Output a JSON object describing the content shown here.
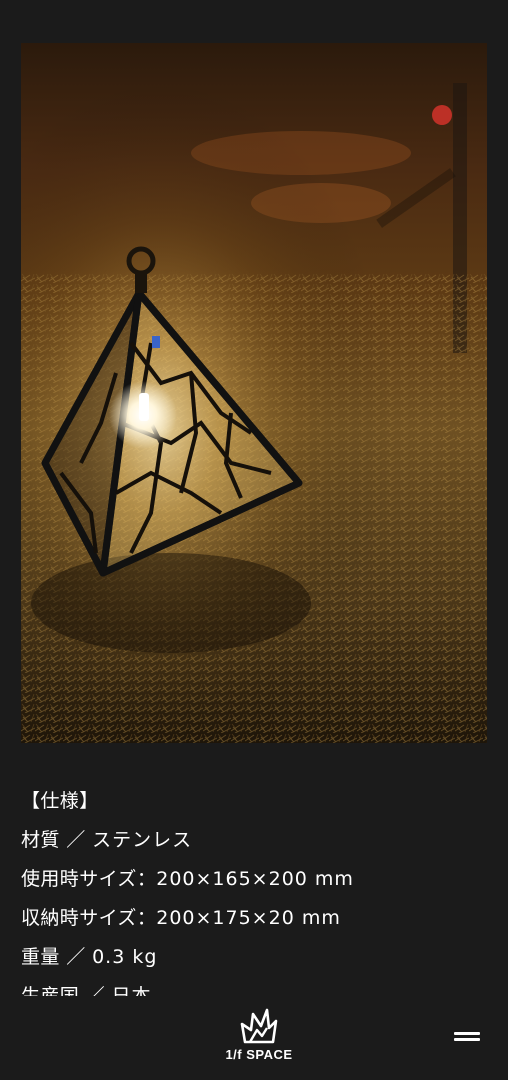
{
  "photo": {
    "alt": "Pyramid-shaped stainless steel lantern glowing on dry grass at night"
  },
  "specs": {
    "heading": "【仕様】",
    "lines": [
      {
        "label": "材質 ／ ",
        "value": "ステンレス"
      },
      {
        "label": "使用時サイズ：",
        "value": "200×165×200 mm"
      },
      {
        "label": "収納時サイズ：",
        "value": "200×175×20 mm"
      },
      {
        "label": "重量 ／ ",
        "value": "0.3 kg"
      },
      {
        "label": "生産国 ／ ",
        "value": "日本"
      }
    ]
  },
  "footer": {
    "logo_text": "1/f SPACE",
    "logo_icon": "flame-crown-icon",
    "menu_icon": "hamburger-menu-icon"
  },
  "colors": {
    "background": "#1b1b1b",
    "text": "#ffffff",
    "lantern_glow": "#fff4d6",
    "grass": "#a27a35"
  }
}
